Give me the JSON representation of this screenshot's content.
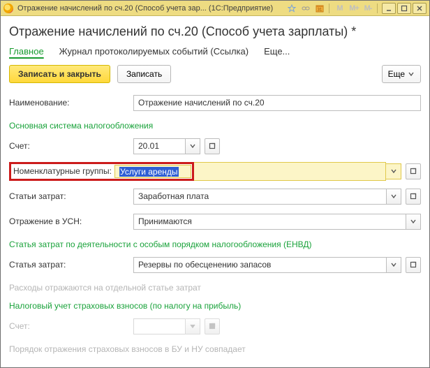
{
  "titlebar": {
    "text": "Отражение начислений по сч.20 (Способ учета зар...   (1С:Предприятие)"
  },
  "page_title": "Отражение начислений по сч.20 (Способ учета зарплаты) *",
  "tabs": {
    "main": "Главное",
    "journal": "Журнал протоколируемых событий (Ссылка)",
    "more": "Еще..."
  },
  "toolbar": {
    "save_close": "Записать и закрыть",
    "save": "Записать",
    "more": "Еще"
  },
  "labels": {
    "name": "Наименование:",
    "section_main_tax": "Основная система налогообложения",
    "account": "Счет:",
    "nomen": "Номенклатурные группы:",
    "cost_items": "Статьи затрат:",
    "usn": "Отражение в УСН:",
    "section_envd": "Статья затрат по деятельности с особым порядком налогообложения (ЕНВД)",
    "cost_item2": "Статья затрат:",
    "hint_envd": "Расходы отражаются на отдельной статье затрат",
    "section_ins": "Налоговый учет страховых взносов (по налогу на прибыль)",
    "account2": "Счет:",
    "hint_ins": "Порядок отражения страховых взносов в БУ и НУ совпадает"
  },
  "values": {
    "name": "Отражение начислений по сч.20",
    "account": "20.01",
    "nomen": "Услуги аренды",
    "cost_items": "Заработная плата",
    "usn": "Принимаются",
    "cost_item2": "Резервы по обесценению запасов",
    "account2": ""
  }
}
